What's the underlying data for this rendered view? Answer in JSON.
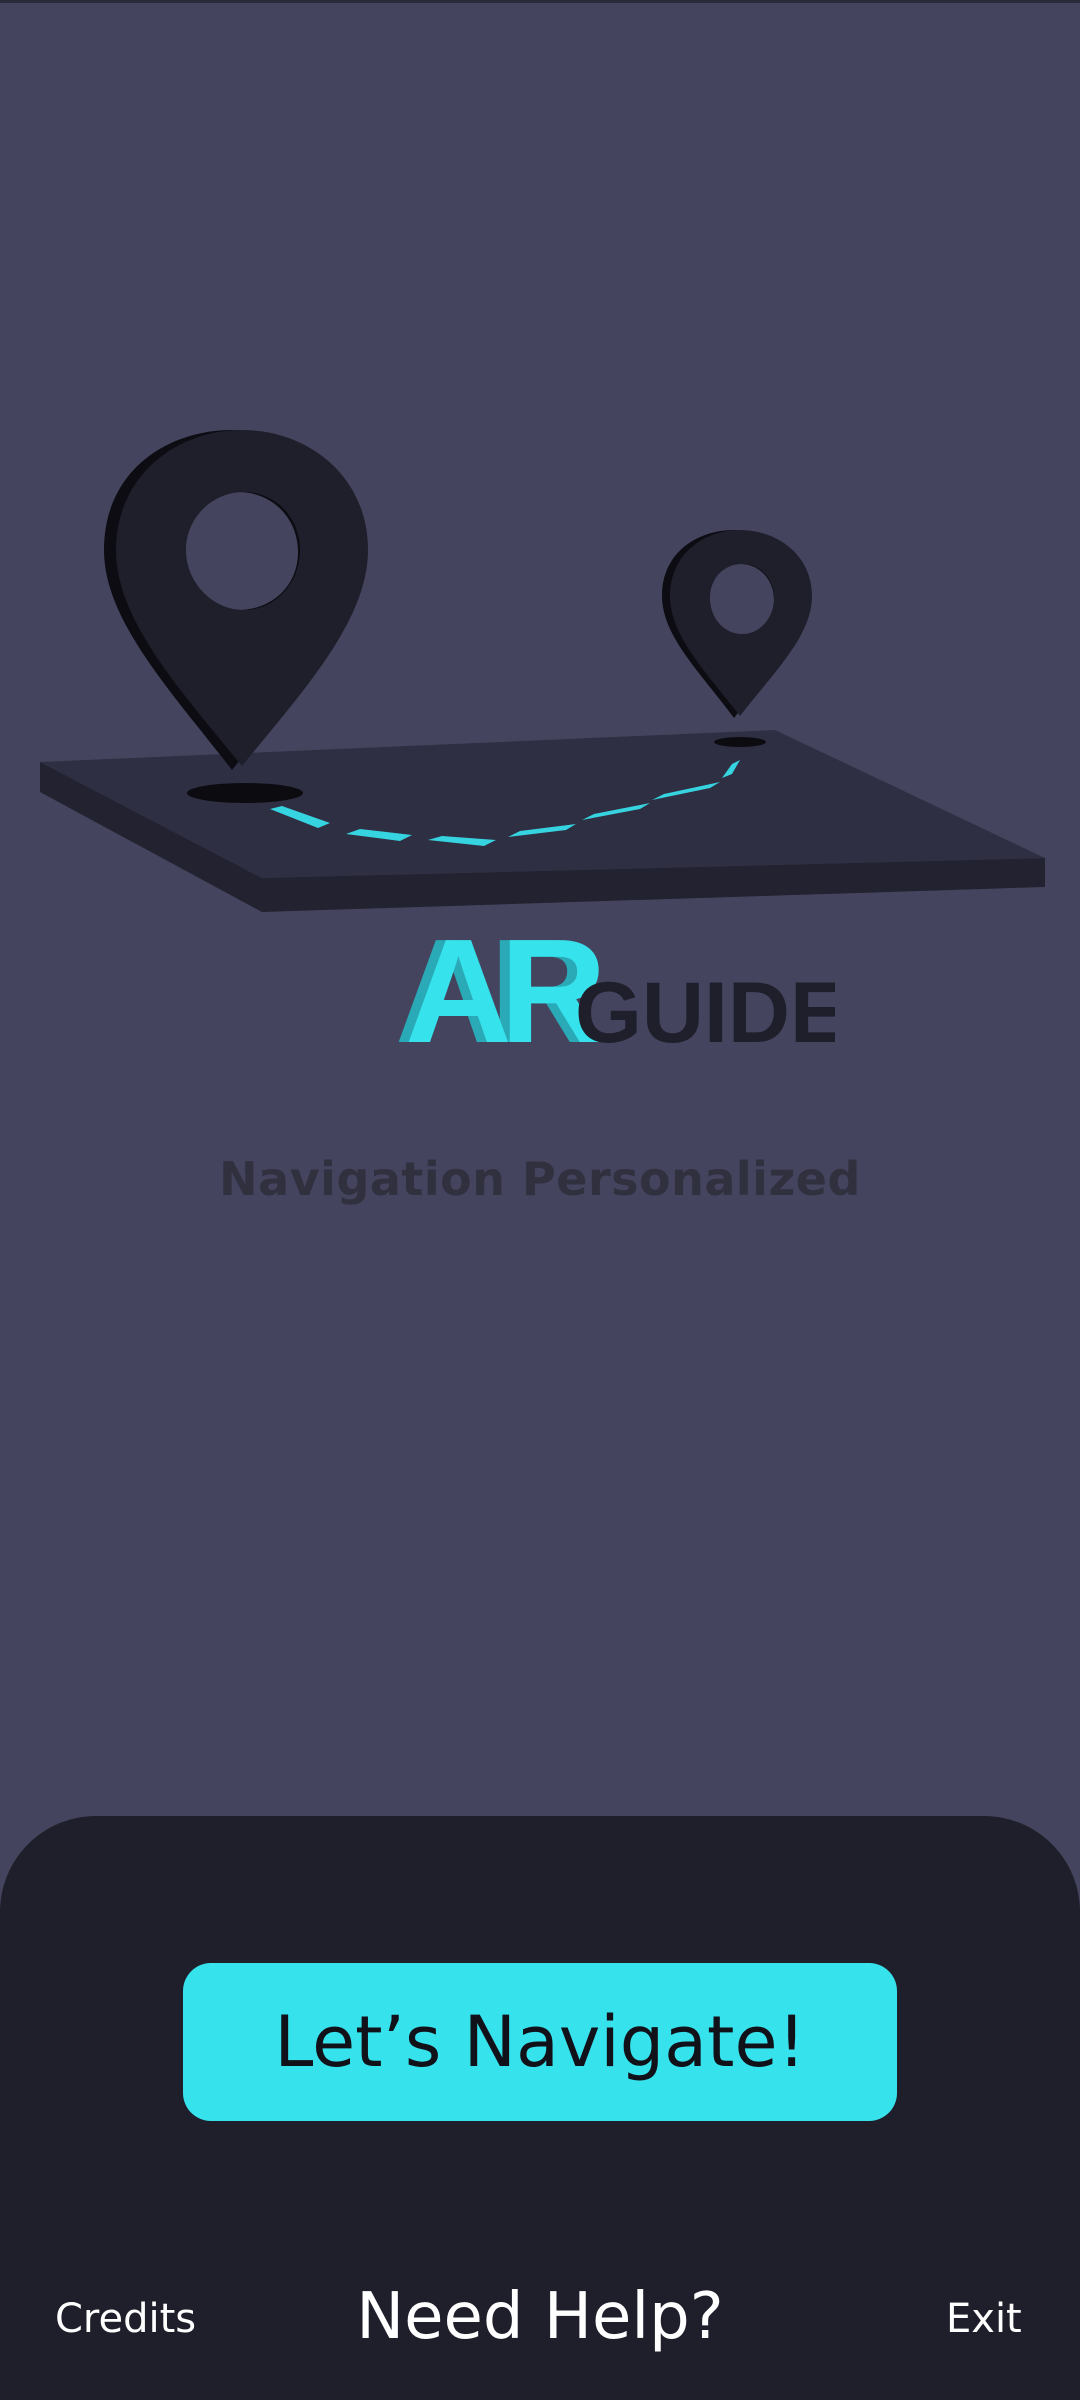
{
  "brand": {
    "logo_primary": "AR",
    "logo_secondary": "GUIDE",
    "tagline": "Navigation Personalized"
  },
  "hero": {
    "illustration": "map-route-with-location-pins"
  },
  "actions": {
    "primary_label": "Let’s Navigate!",
    "credits_label": "Credits",
    "help_label": "Need Help?",
    "exit_label": "Exit"
  },
  "colors": {
    "background": "#44445e",
    "panel": "#1f1f2c",
    "accent": "#36e2ec",
    "pin": "#1f1f2c",
    "text_on_dark": "#ffffff"
  }
}
